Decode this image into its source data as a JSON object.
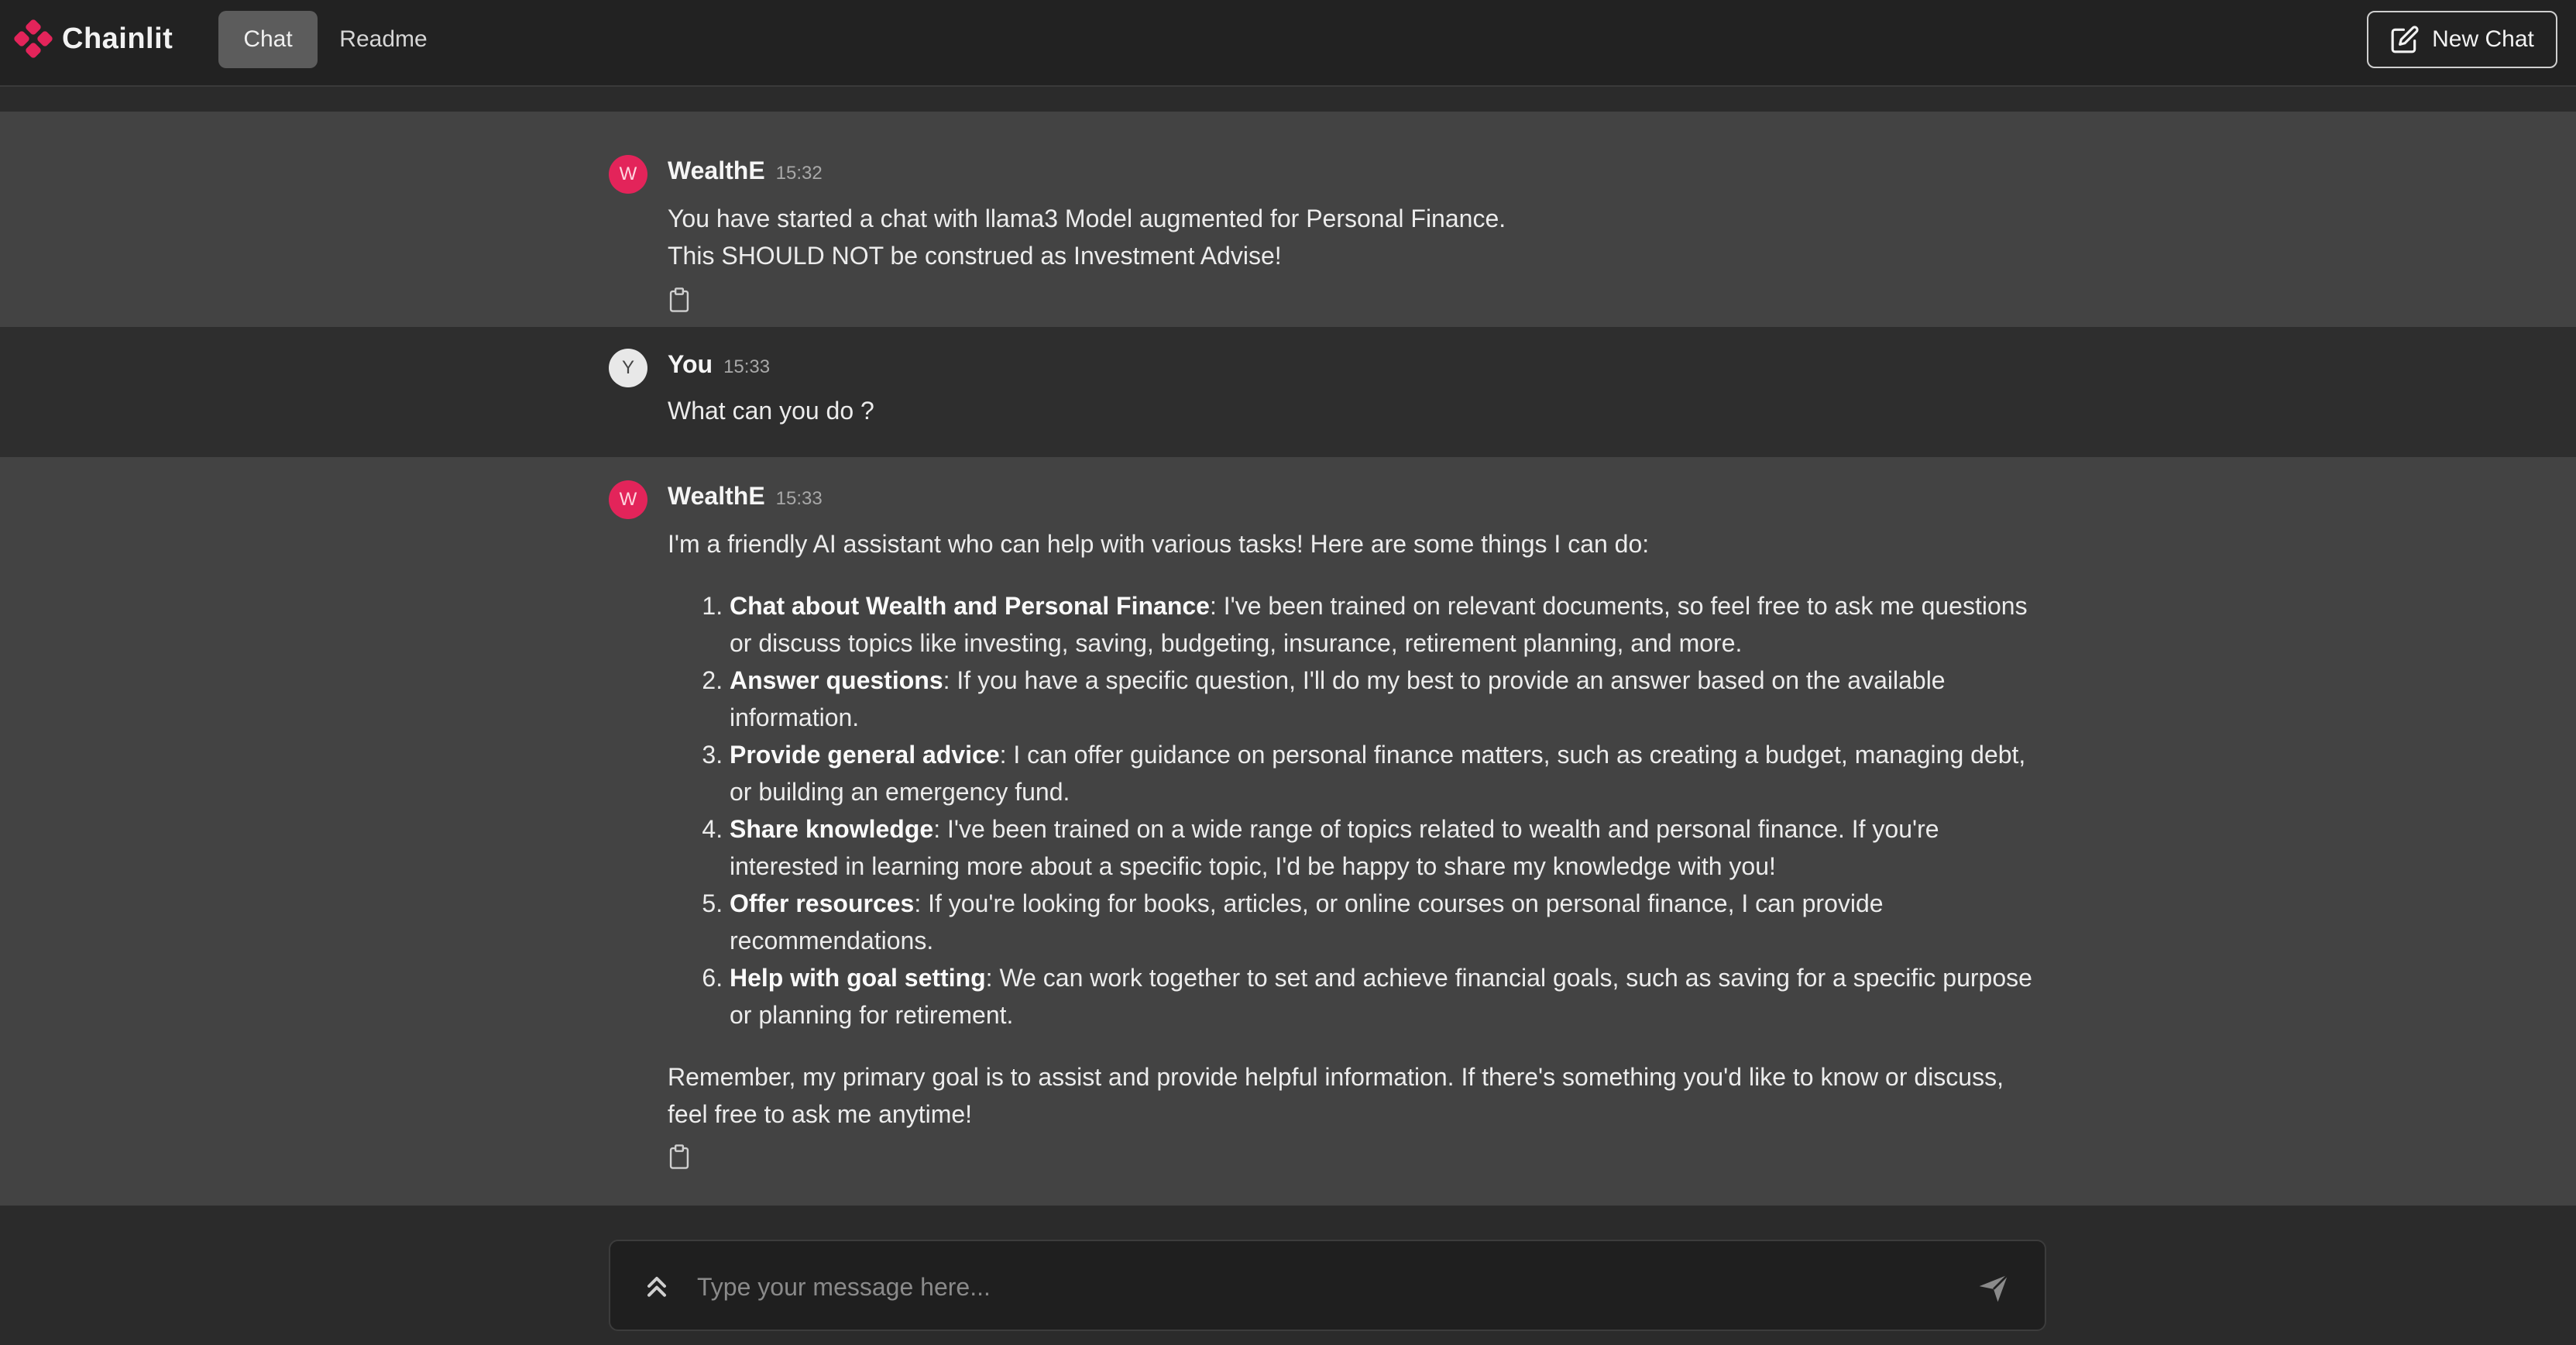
{
  "header": {
    "app_name": "Chainlit",
    "tabs": [
      {
        "label": "Chat",
        "active": true
      },
      {
        "label": "Readme",
        "active": false
      }
    ],
    "new_chat_label": "New Chat",
    "brand_color": "#e3245a"
  },
  "messages": [
    {
      "author": "WealthE",
      "avatar_letter": "W",
      "time": "15:32",
      "lines": [
        "You have started a chat with llama3 Model augmented for Personal Finance.",
        "This SHOULD NOT be construed as Investment Advise!"
      ]
    },
    {
      "author": "You",
      "avatar_letter": "Y",
      "time": "15:33",
      "lines": [
        "What can you do ?"
      ]
    },
    {
      "author": "WealthE",
      "avatar_letter": "W",
      "time": "15:33",
      "intro": "I'm a friendly AI assistant who can help with various tasks! Here are some things I can do:",
      "items": [
        {
          "title": "Chat about Wealth and Personal Finance",
          "text": ": I've been trained on relevant documents, so feel free to ask me questions or discuss topics like investing, saving, budgeting, insurance, retirement planning, and more."
        },
        {
          "title": "Answer questions",
          "text": ": If you have a specific question, I'll do my best to provide an answer based on the available information."
        },
        {
          "title": "Provide general advice",
          "text": ": I can offer guidance on personal finance matters, such as creating a budget, managing debt, or building an emergency fund."
        },
        {
          "title": "Share knowledge",
          "text": ": I've been trained on a wide range of topics related to wealth and personal finance. If you're interested in learning more about a specific topic, I'd be happy to share my knowledge with you!"
        },
        {
          "title": "Offer resources",
          "text": ": If you're looking for books, articles, or online courses on personal finance, I can provide recommendations."
        },
        {
          "title": "Help with goal setting",
          "text": ": We can work together to set and achieve financial goals, such as saving for a specific purpose or planning for retirement."
        }
      ],
      "outro": "Remember, my primary goal is to assist and provide helpful information. If there's something you'd like to know or discuss, feel free to ask me anytime!"
    }
  ],
  "composer": {
    "placeholder": "Type your message here...",
    "expand_icon": "chevrons-up-icon",
    "send_icon": "send-icon"
  }
}
